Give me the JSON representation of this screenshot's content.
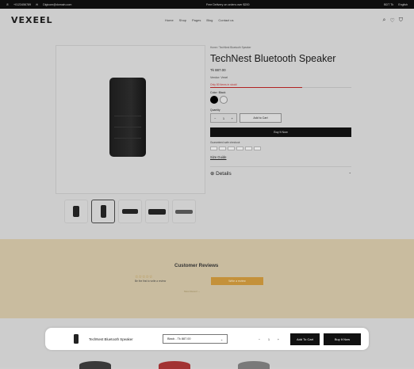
{
  "topbar": {
    "phone": "+0123456789",
    "email": "Digicom@domain.com",
    "promo": "Free Delivery on orders over $200",
    "currency": "BDT Tk",
    "language": "English"
  },
  "header": {
    "logo": "VEXEEL",
    "nav": [
      "Home",
      "Shop",
      "Pages",
      "Blog",
      "Contact us"
    ],
    "cart_count": "0",
    "wishlist_count": "0"
  },
  "product": {
    "breadcrumb": "Home  /  TechNest Bluetooth Speaker",
    "title": "TechNest Bluetooth Speaker",
    "price": "Tk 887.00",
    "vendor": "Vendor: Vexel",
    "stock_text": "Only 80 items in stock!",
    "stock_fraction": 0.65,
    "color_label": "Color: Black",
    "quantity_label": "Quantity",
    "quantity": "1",
    "add_to_cart": "Add to Cart",
    "buy_now": "Buy It Now",
    "guarantee": "Guaranteed safe checkout",
    "size_guide": "Size Guide",
    "details": "Details"
  },
  "reviews": {
    "title": "Customer Reviews",
    "stars": "☆☆☆☆☆",
    "first_text": "Be the first to write a review",
    "write_button": "Write a review",
    "more": "Most Recent"
  },
  "sticky": {
    "name": "TechNest Bluetooth Speaker",
    "variant": "Black - Tk 887.00",
    "quantity": "1",
    "add_to_cart": "Add To Cart",
    "buy_now": "Buy It Now"
  },
  "colors": {
    "topbar": "#0e0e0e",
    "stock_bar": "#b22222",
    "write_button": "#c4913a"
  }
}
